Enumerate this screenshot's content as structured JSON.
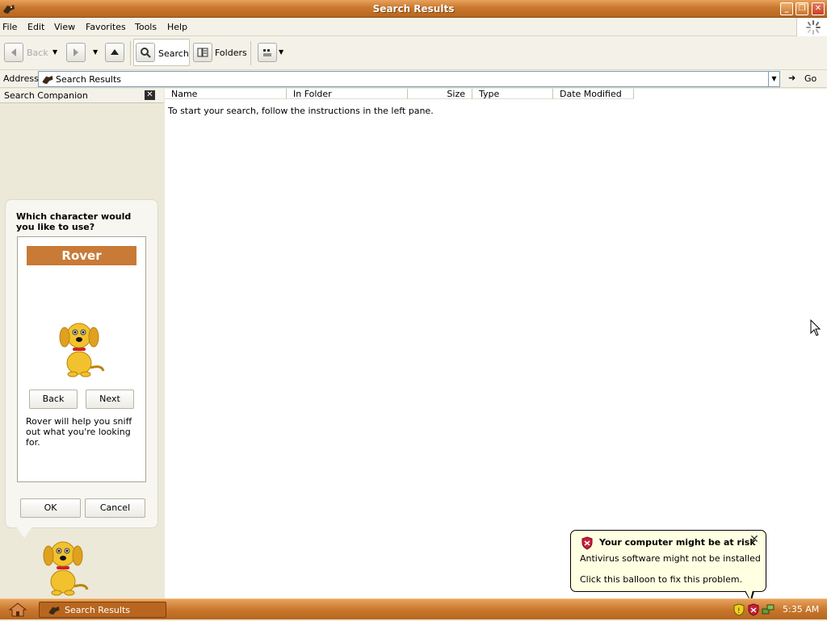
{
  "window": {
    "title": "Search Results"
  },
  "menu": [
    "File",
    "Edit",
    "View",
    "Favorites",
    "Tools",
    "Help"
  ],
  "toolbar": {
    "back_label": "Back",
    "search_label": "Search",
    "folders_label": "Folders"
  },
  "address": {
    "label": "Address",
    "value": "Search Results",
    "go_label": "Go"
  },
  "left_pane": {
    "title": "Search Companion",
    "question": "Which character would you like to use?",
    "character_name": "Rover",
    "back_label": "Back",
    "next_label": "Next",
    "description": "Rover will help you sniff out what you're looking for.",
    "ok_label": "OK",
    "cancel_label": "Cancel"
  },
  "content": {
    "columns": [
      "Name",
      "In Folder",
      "Size",
      "Type",
      "Date Modified"
    ],
    "instructions": "To start your search, follow the instructions in the left pane."
  },
  "balloon": {
    "title": "Your computer might be at risk",
    "line1": "Antivirus software might not be installed",
    "line2": "Click this balloon to fix this problem."
  },
  "taskbar": {
    "task_label": "Search Results",
    "clock": "5:35 AM"
  },
  "icons": {
    "app": "search-dog-icon",
    "shield": "security-shield-icon"
  },
  "colors": {
    "accent": "#c97a36",
    "balloon_bg": "#ffffe1"
  }
}
